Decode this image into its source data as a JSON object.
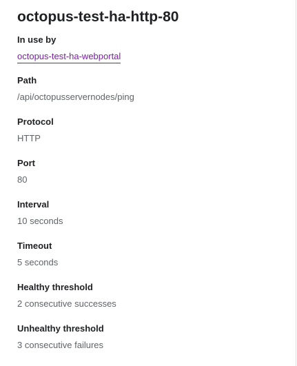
{
  "title": "octopus-test-ha-http-80",
  "in_use_by": {
    "label": "In use by",
    "link": "octopus-test-ha-webportal"
  },
  "fields": {
    "path": {
      "label": "Path",
      "value": "/api/octopusservernodes/ping"
    },
    "protocol": {
      "label": "Protocol",
      "value": "HTTP"
    },
    "port": {
      "label": "Port",
      "value": "80"
    },
    "interval": {
      "label": "Interval",
      "value": "10 seconds"
    },
    "timeout": {
      "label": "Timeout",
      "value": "5 seconds"
    },
    "healthy_threshold": {
      "label": "Healthy threshold",
      "value": "2 consecutive successes"
    },
    "unhealthy_threshold": {
      "label": "Unhealthy threshold",
      "value": "3 consecutive failures"
    }
  },
  "colors": {
    "link": "#7b1fa2",
    "label": "#202124",
    "value": "#5f6368"
  }
}
